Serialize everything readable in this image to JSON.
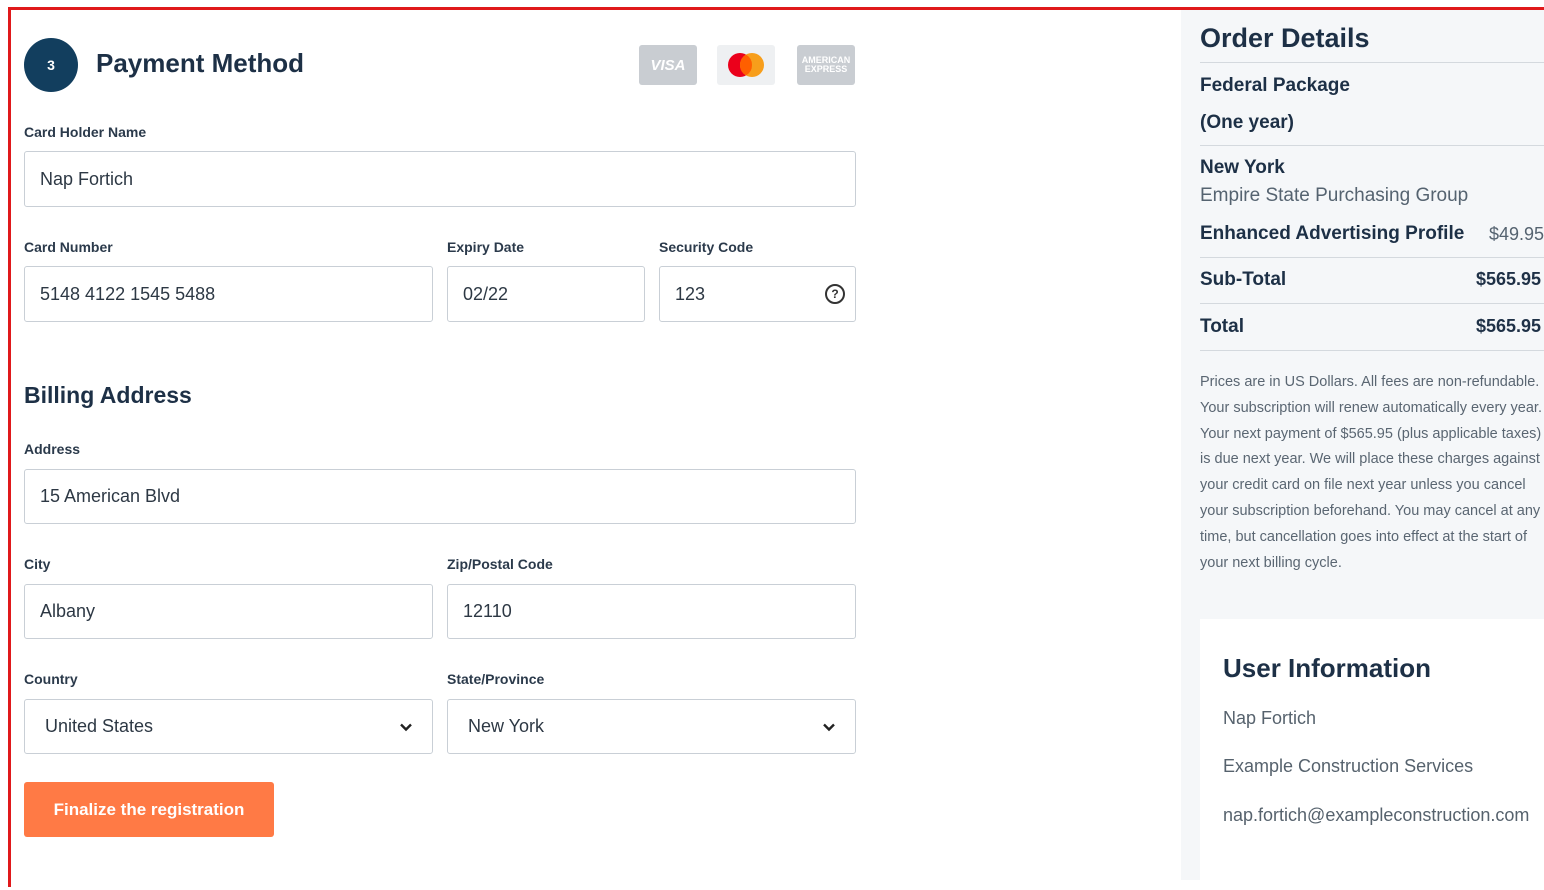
{
  "payment": {
    "step": "3",
    "title": "Payment Method",
    "cards": {
      "visa": "VISA",
      "amex_line1": "AMERICAN",
      "amex_line2": "EXPRESS"
    },
    "card_holder_label": "Card Holder Name",
    "card_holder_value": "Nap Fortich",
    "card_number_label": "Card Number",
    "card_number_value": "5148 4122 1545 5488",
    "expiry_label": "Expiry Date",
    "expiry_value": "02/22",
    "security_label": "Security Code",
    "security_value": "123"
  },
  "billing": {
    "title": "Billing Address",
    "address_label": "Address",
    "address_value": "15 American Blvd",
    "city_label": "City",
    "city_value": "Albany",
    "zip_label": "Zip/Postal Code",
    "zip_value": "12110",
    "country_label": "Country",
    "country_value": "United States",
    "state_label": "State/Province",
    "state_value": "New York"
  },
  "finalize_label": "Finalize the registration",
  "order": {
    "title": "Order Details",
    "package_name": "Federal Package",
    "package_term": "(One year)",
    "state": "New York",
    "group": "Empire State Purchasing Group",
    "addon_label": "Enhanced Advertising Profile",
    "addon_price": "$49.95",
    "subtotal_label": "Sub-Total",
    "subtotal_value": "$565.95",
    "total_label": "Total",
    "total_value": "$565.95",
    "notice": "Prices are in US Dollars. All fees are non-refundable. Your subscription will renew automatically every year. Your next payment of $565.95 (plus applicable taxes) is due next year. We will place these charges against your credit card on file next year unless you cancel your subscription beforehand. You may cancel at any time, but cancellation goes into effect at the start of your next billing cycle."
  },
  "user": {
    "title": "User Information",
    "name": "Nap Fortich",
    "company": "Example Construction Services",
    "email": "nap.fortich@exampleconstruction.com"
  },
  "colors": {
    "accent": "#ff7a45",
    "step": "#123e5e",
    "frame": "#e0191b"
  }
}
